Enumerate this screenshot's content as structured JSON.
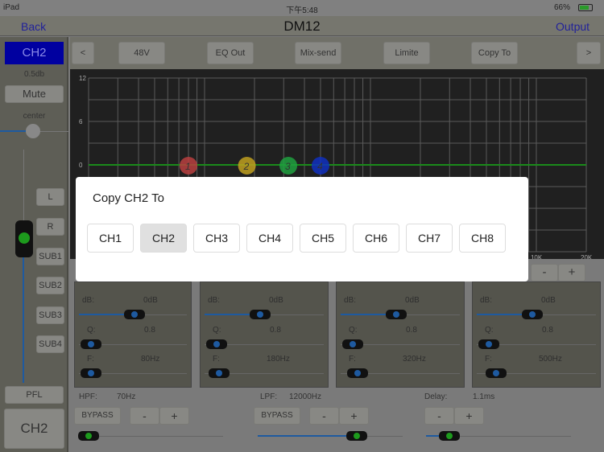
{
  "status_bar": {
    "device": "iPad",
    "time": "下午5:48",
    "battery": "66%"
  },
  "nav": {
    "back": "Back",
    "title": "DM12",
    "output": "Output"
  },
  "left_panel": {
    "channel": "CH2",
    "gain": "0.5db",
    "mute": "Mute",
    "pan": "center",
    "routes": [
      "L",
      "R",
      "SUB1",
      "SUB2",
      "SUB3",
      "SUB4"
    ],
    "pfl": "PFL",
    "channel_bottom": "CH2"
  },
  "toolbar": {
    "prev": "<",
    "buttons": [
      "48V",
      "EQ Out",
      "Mix-send",
      "Limite",
      "Copy To"
    ],
    "next": ">"
  },
  "chart_data": {
    "type": "line",
    "y_ticks": [
      "12",
      "6",
      "0"
    ],
    "x_ticks": [
      "10K",
      "20K"
    ],
    "ylim": [
      -12,
      12
    ],
    "xlim": [
      20,
      20000
    ],
    "x_scale": "log",
    "grid": true,
    "markers": [
      {
        "label": "1",
        "freq": 80,
        "gain": 0,
        "color": "#b84040"
      },
      {
        "label": "2",
        "freq": 180,
        "gain": 0,
        "color": "#c0a020"
      },
      {
        "label": "3",
        "freq": 320,
        "gain": 0,
        "color": "#20a040"
      },
      {
        "label": "4",
        "freq": 500,
        "gain": 0,
        "color": "#1030c0"
      }
    ],
    "line_color": "#1a8a1a"
  },
  "graph_controls": {
    "minus": "-",
    "plus": "+"
  },
  "bands": [
    {
      "db_label": "dB:",
      "db": "0dB",
      "q_label": "Q:",
      "q": "0.8",
      "f_label": "F:",
      "f": "80Hz"
    },
    {
      "db_label": "dB:",
      "db": "0dB",
      "q_label": "Q:",
      "q": "0.8",
      "f_label": "F:",
      "f": "180Hz"
    },
    {
      "db_label": "dB:",
      "db": "0dB",
      "q_label": "Q:",
      "q": "0.8",
      "f_label": "F:",
      "f": "320Hz"
    },
    {
      "db_label": "dB:",
      "db": "0dB",
      "q_label": "Q:",
      "q": "0.8",
      "f_label": "F:",
      "f": "500Hz"
    }
  ],
  "hpf": {
    "label": "HPF:",
    "value": "70Hz",
    "bypass": "BYPASS",
    "minus": "-",
    "plus": "+"
  },
  "lpf": {
    "label": "LPF:",
    "value": "12000Hz",
    "bypass": "BYPASS",
    "minus": "-",
    "plus": "+"
  },
  "delay": {
    "label": "Delay:",
    "value": "1.1ms",
    "minus": "-",
    "plus": "+"
  },
  "modal": {
    "title": "Copy CH2 To",
    "channels": [
      "CH1",
      "CH2",
      "CH3",
      "CH4",
      "CH5",
      "CH6",
      "CH7",
      "CH8"
    ],
    "selected": "CH2"
  }
}
